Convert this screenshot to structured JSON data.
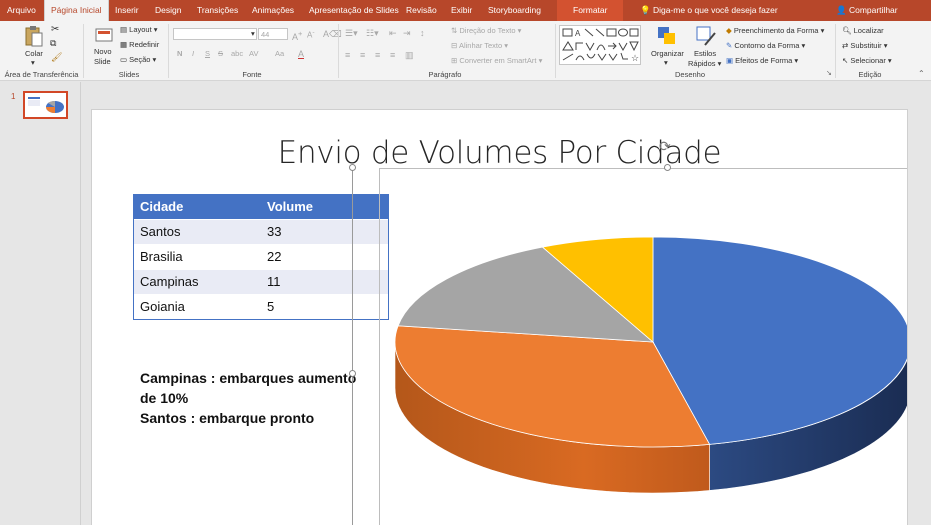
{
  "tabs": {
    "arquivo": "Arquivo",
    "pagina_inicial": "Página Inicial",
    "inserir": "Inserir",
    "design": "Design",
    "transicoes": "Transições",
    "animacoes": "Animações",
    "apresentacao": "Apresentação de Slides",
    "revisao": "Revisão",
    "exibir": "Exibir",
    "storyboarding": "Storyboarding",
    "formatar": "Formatar"
  },
  "tell_me": "Diga-me o que você deseja fazer",
  "share": "Compartilhar",
  "ribbon": {
    "clipboard": {
      "colar": "Colar",
      "label": "Área de Transferência"
    },
    "slides": {
      "novo_slide_1": "Novo",
      "novo_slide_2": "Slide",
      "layout": "Layout",
      "redefinir": "Redefinir",
      "secao": "Seção",
      "label": "Slides"
    },
    "fonte": {
      "font_size": "44",
      "label": "Fonte",
      "bold": "N",
      "italic": "I",
      "underline": "S",
      "strike": "S",
      "shadow": "abc",
      "spacing": "AV",
      "case": "Aa",
      "clear": "A"
    },
    "paragrafo": {
      "direcao": "Direção do Texto",
      "alinhar": "Alinhar Texto",
      "converter": "Converter em SmartArt",
      "label": "Parágrafo"
    },
    "desenho": {
      "organizar": "Organizar",
      "estilos_1": "Estilos",
      "estilos_2": "Rápidos",
      "preenchimento": "Preenchimento da Forma",
      "contorno": "Contorno da Forma",
      "efeitos": "Efeitos de Forma",
      "label": "Desenho"
    },
    "edicao": {
      "localizar": "Localizar",
      "substituir": "Substituir",
      "selecionar": "Selecionar",
      "label": "Edição"
    }
  },
  "slide_number": "1",
  "slide": {
    "title": "Envio de Volumes Por Cidade",
    "table": {
      "headers": [
        "Cidade",
        "Volume"
      ],
      "rows": [
        [
          "Santos",
          "33"
        ],
        [
          "Brasilia",
          "22"
        ],
        [
          "Campinas",
          "11"
        ],
        [
          "Goiania",
          "5"
        ]
      ]
    },
    "notes": [
      "Campinas : embarques aumento",
      "de 10%",
      "Santos : embarque pronto"
    ]
  },
  "colors": {
    "accent": "#b7472a",
    "table_header": "#4472c4",
    "santos": "#4472c4",
    "brasilia": "#ed7d31",
    "campinas": "#a5a5a5",
    "goiania": "#ffc000"
  },
  "chart_data": {
    "type": "pie",
    "title": "",
    "categories": [
      "Santos",
      "Brasilia",
      "Campinas",
      "Goiania"
    ],
    "values": [
      33,
      22,
      11,
      5
    ],
    "style": "3d-pie"
  }
}
